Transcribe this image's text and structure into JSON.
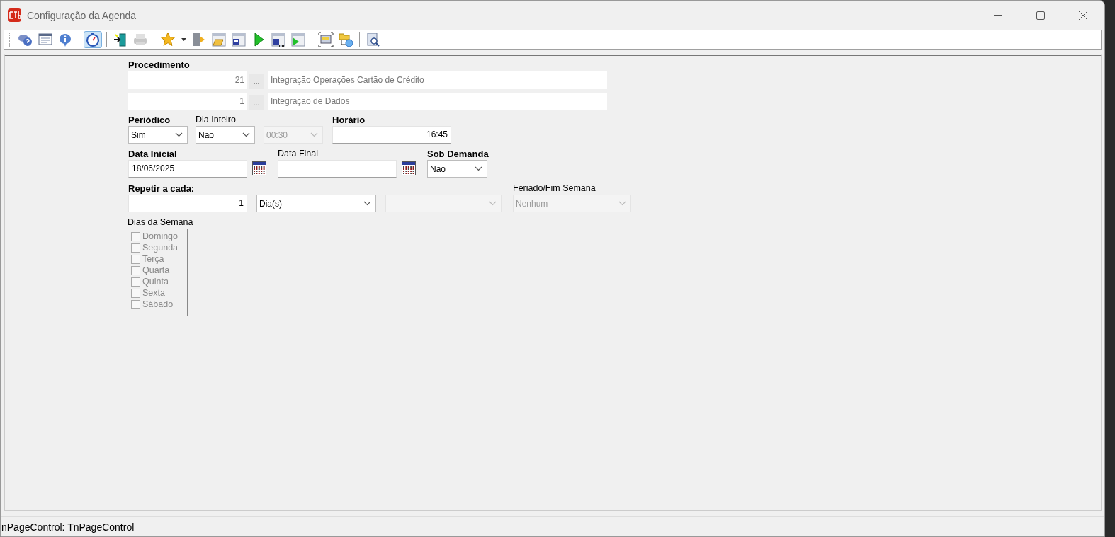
{
  "window": {
    "title": "Configuração da Agenda"
  },
  "toolbar": [
    {
      "kind": "help",
      "pressed": false,
      "disabled": false
    },
    {
      "kind": "form",
      "pressed": false,
      "disabled": false
    },
    {
      "kind": "info",
      "pressed": false,
      "disabled": false
    },
    {
      "kind": "separator"
    },
    {
      "kind": "timer",
      "pressed": true,
      "disabled": false
    },
    {
      "kind": "separator"
    },
    {
      "kind": "exit",
      "pressed": false,
      "disabled": false
    },
    {
      "kind": "print",
      "pressed": false,
      "disabled": true
    },
    {
      "kind": "separator"
    },
    {
      "kind": "favorite",
      "pressed": false,
      "disabled": false
    },
    {
      "kind": "dropdown",
      "pressed": false,
      "disabled": false
    },
    {
      "kind": "door",
      "pressed": false,
      "disabled": false
    },
    {
      "kind": "open",
      "pressed": false,
      "disabled": false
    },
    {
      "kind": "save",
      "pressed": false,
      "disabled": false
    },
    {
      "kind": "run",
      "pressed": false,
      "disabled": false
    },
    {
      "kind": "saveall",
      "pressed": false,
      "disabled": false
    },
    {
      "kind": "runall",
      "pressed": false,
      "disabled": false
    },
    {
      "kind": "separator"
    },
    {
      "kind": "select",
      "pressed": false,
      "disabled": false
    },
    {
      "kind": "link",
      "pressed": false,
      "disabled": false
    },
    {
      "kind": "separator"
    },
    {
      "kind": "preview",
      "pressed": false,
      "disabled": false
    }
  ],
  "form": {
    "procedure": {
      "label": "Procedimento",
      "rows": [
        {
          "code": "21",
          "name": "Integração Operações Cartão de Crédito"
        },
        {
          "code": "1",
          "name": "Integração de Dados"
        }
      ],
      "lookup_button": "..."
    },
    "periodic": {
      "label": "Periódico",
      "value": "Sim"
    },
    "all_day": {
      "label": "Dia Inteiro",
      "value": "Não"
    },
    "interval": {
      "value": "00:30",
      "disabled": true
    },
    "time": {
      "label": "Horário",
      "value": "16:45"
    },
    "start_date": {
      "label": "Data Inicial",
      "value": "18/06/2025"
    },
    "end_date": {
      "label": "Data Final"
    },
    "on_demand": {
      "label": "Sob Demanda",
      "value": "Não"
    },
    "repeat": {
      "label": "Repetir a cada:",
      "value": "1",
      "unit": "Dia(s)",
      "extra": {
        "disabled": true
      }
    },
    "holiday": {
      "label": "Feriado/Fim Semana",
      "value": "Nenhum",
      "disabled": true
    },
    "weekdays": {
      "label": "Dias da Semana",
      "disabled": true,
      "days": [
        {
          "label": "Domingo",
          "checked": false
        },
        {
          "label": "Segunda",
          "checked": false
        },
        {
          "label": "Terça",
          "checked": false
        },
        {
          "label": "Quarta",
          "checked": false
        },
        {
          "label": "Quinta",
          "checked": false
        },
        {
          "label": "Sexta",
          "checked": false
        },
        {
          "label": "Sábado",
          "checked": false
        }
      ]
    }
  },
  "status_bar": "nPageControl: TnPageControl"
}
